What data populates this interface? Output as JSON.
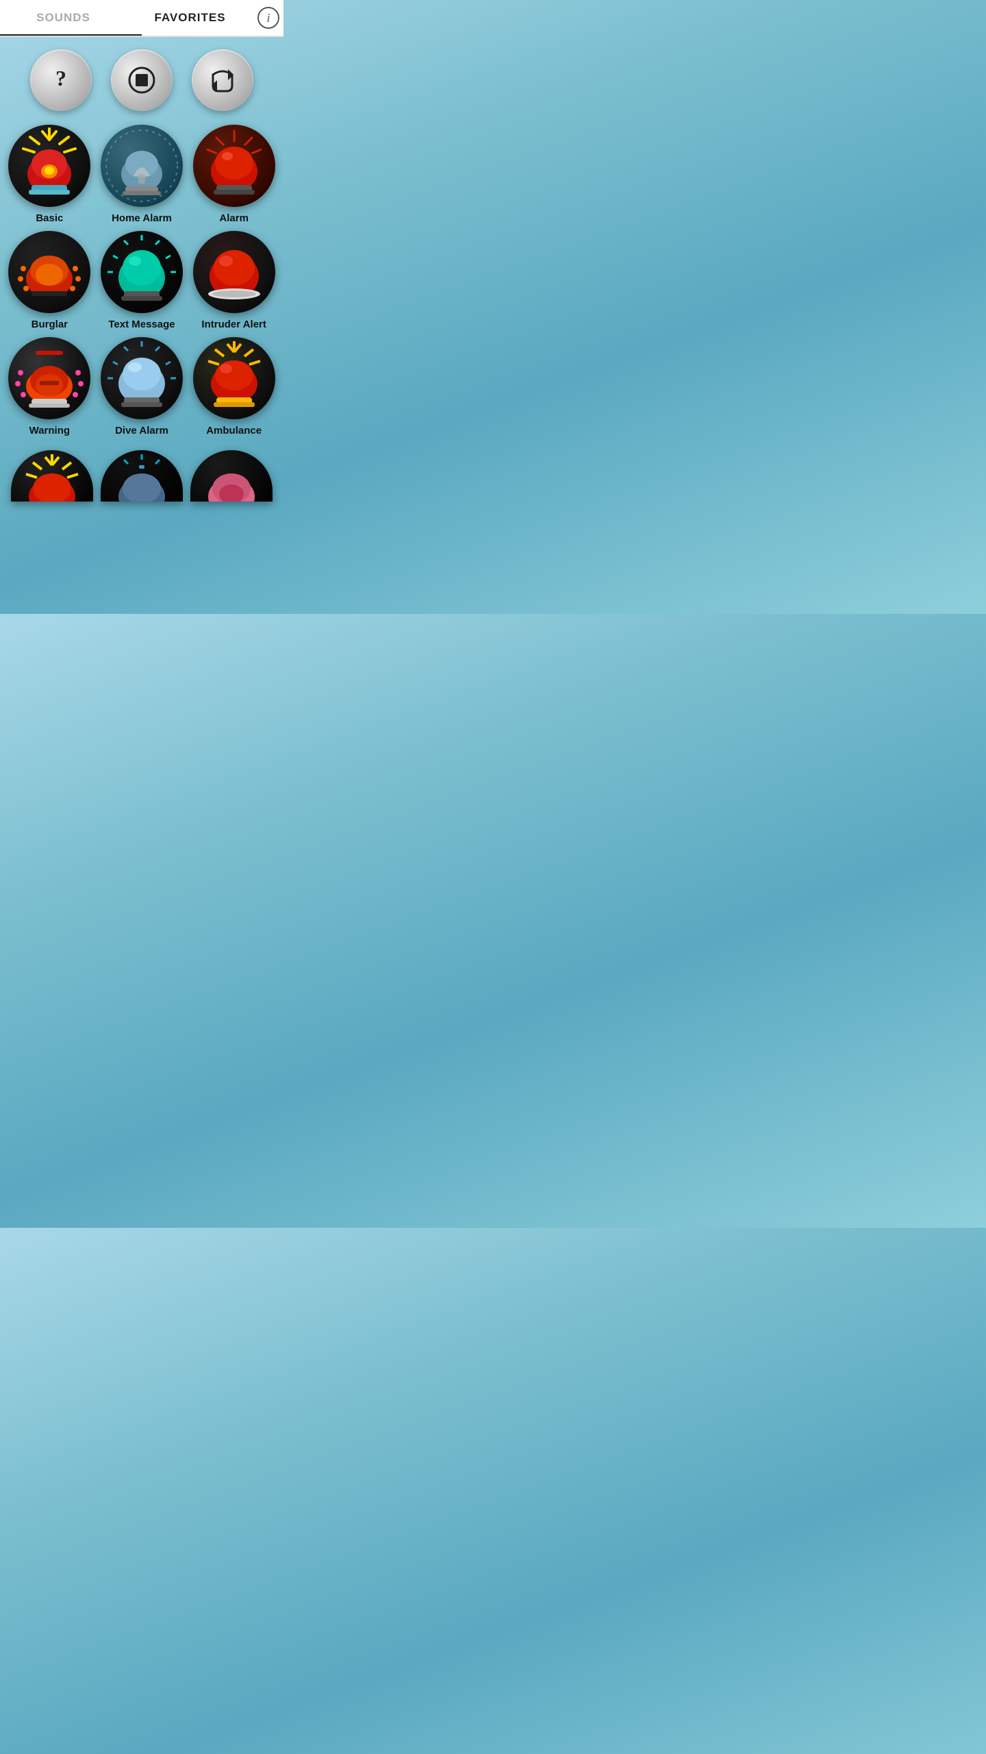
{
  "tabs": [
    {
      "id": "sounds",
      "label": "SOUNDS",
      "active": false
    },
    {
      "id": "favorites",
      "label": "FAVORITES",
      "active": true
    }
  ],
  "info_label": "i",
  "controls": [
    {
      "id": "help",
      "icon": "question",
      "label": "Help"
    },
    {
      "id": "stop",
      "icon": "stop",
      "label": "Stop"
    },
    {
      "id": "repeat",
      "icon": "repeat",
      "label": "Repeat"
    }
  ],
  "sounds": [
    {
      "id": "basic",
      "label": "Basic",
      "icon_class": "icon-basic"
    },
    {
      "id": "home-alarm",
      "label": "Home Alarm",
      "icon_class": "icon-home"
    },
    {
      "id": "alarm",
      "label": "Alarm",
      "icon_class": "icon-alarm"
    },
    {
      "id": "burglar",
      "label": "Burglar",
      "icon_class": "icon-burglar"
    },
    {
      "id": "text-message",
      "label": "Text Message",
      "icon_class": "icon-textmsg"
    },
    {
      "id": "intruder-alert",
      "label": "Intruder Alert",
      "icon_class": "icon-intruder"
    },
    {
      "id": "warning",
      "label": "Warning",
      "icon_class": "icon-warning"
    },
    {
      "id": "dive-alarm",
      "label": "Dive Alarm",
      "icon_class": "icon-dive"
    },
    {
      "id": "ambulance",
      "label": "Ambulance",
      "icon_class": "icon-ambulance"
    }
  ],
  "partial_sounds": [
    {
      "id": "partial-1",
      "icon_class": "icon-partial1"
    },
    {
      "id": "partial-2",
      "icon_class": "icon-partial2"
    },
    {
      "id": "partial-3",
      "icon_class": "icon-partial3"
    }
  ]
}
